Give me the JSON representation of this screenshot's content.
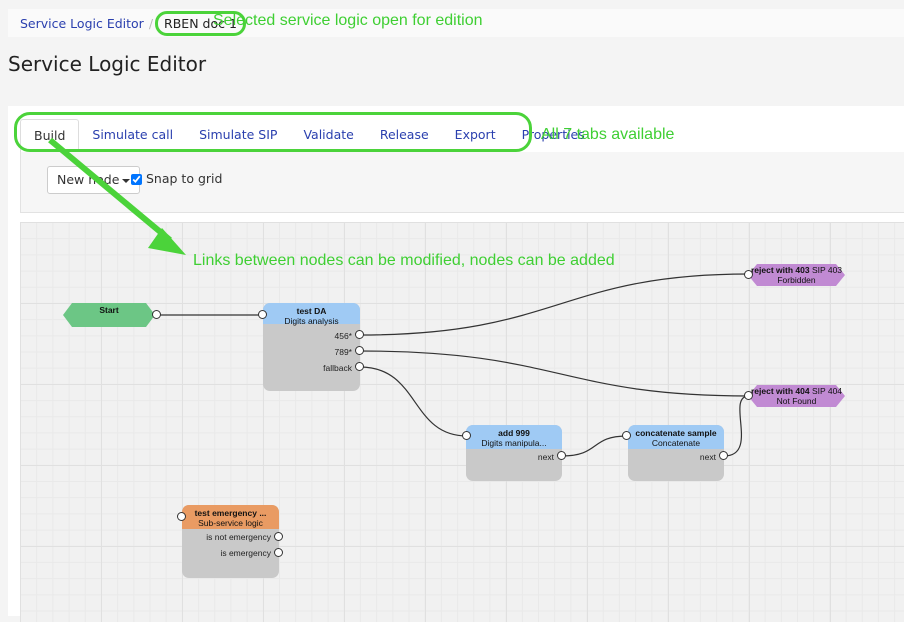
{
  "breadcrumb": {
    "root": "Service Logic Editor",
    "separator": "/",
    "current": "RBEN doc 1"
  },
  "page_title": "Service Logic Editor",
  "tabs": [
    {
      "label": "Build",
      "active": true
    },
    {
      "label": "Simulate call",
      "active": false
    },
    {
      "label": "Simulate SIP",
      "active": false
    },
    {
      "label": "Validate",
      "active": false
    },
    {
      "label": "Release",
      "active": false
    },
    {
      "label": "Export",
      "active": false
    },
    {
      "label": "Properties",
      "active": false
    }
  ],
  "toolbar": {
    "new_node_label": "New node",
    "snap_to_grid_label": "Snap to grid",
    "snap_to_grid_checked": true
  },
  "annotations": {
    "breadcrumb_note": "Selected service logic open for edition",
    "tabs_note": "All 7 tabs available",
    "canvas_note": "Links between nodes can be modified, nodes can be added"
  },
  "colors": {
    "annotation_green": "#4bd33a",
    "start_node": "#6cc685",
    "action_header": "#9fcaf4",
    "subservice_header": "#e99b63",
    "reject_node": "#c18ad3",
    "node_body": "#c9c9c9",
    "link_color": "#333333"
  },
  "nodes": {
    "start": {
      "title": "Start"
    },
    "test_da": {
      "title": "test DA",
      "type": "Digits analysis",
      "outputs": [
        "456*",
        "789*",
        "fallback"
      ]
    },
    "add_999": {
      "title": "add 999",
      "type": "Digits manipula...",
      "outputs": [
        "next"
      ]
    },
    "concatenate": {
      "title": "concatenate sample",
      "type": "Concatenate",
      "outputs": [
        "next"
      ]
    },
    "reject_403": {
      "title": "reject with 403",
      "type": "SIP 403 Forbidden"
    },
    "reject_404": {
      "title": "reject with 404",
      "type": "SIP 404 Not Found"
    },
    "test_emergency": {
      "title": "test emergency ...",
      "type": "Sub-service logic",
      "outputs": [
        "is not emergency",
        "is emergency"
      ]
    }
  },
  "links": [
    {
      "from": "start",
      "to": "test_da"
    },
    {
      "from": "test_da:456*",
      "to": "reject_403"
    },
    {
      "from": "test_da:789*",
      "to": "reject_404"
    },
    {
      "from": "test_da:fallback",
      "to": "add_999"
    },
    {
      "from": "add_999:next",
      "to": "concatenate"
    },
    {
      "from": "concatenate:next",
      "to": "reject_404"
    }
  ]
}
